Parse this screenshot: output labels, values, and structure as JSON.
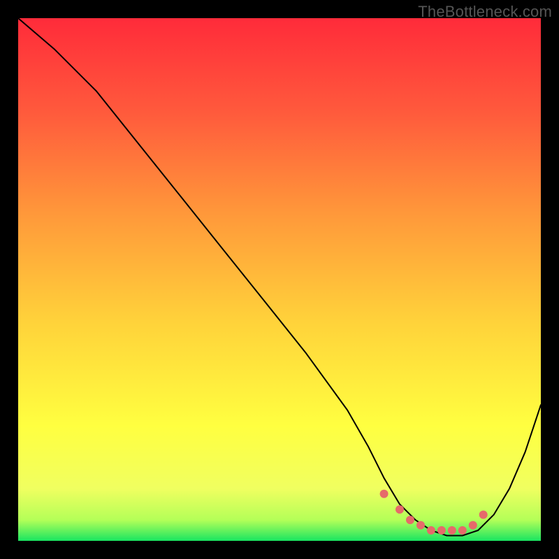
{
  "watermark": "TheBottleneck.com",
  "chart_data": {
    "type": "line",
    "title": "",
    "xlabel": "",
    "ylabel": "",
    "xlim": [
      0,
      100
    ],
    "ylim": [
      0,
      100
    ],
    "y_inverted_display": true,
    "series": [
      {
        "name": "bottleneck-curve",
        "x": [
          0,
          7,
          15,
          23,
          31,
          39,
          47,
          55,
          63,
          67,
          70,
          73,
          76,
          79,
          82,
          85,
          88,
          91,
          94,
          97,
          100
        ],
        "values": [
          100,
          94,
          86,
          76,
          66,
          56,
          46,
          36,
          25,
          18,
          12,
          7,
          4,
          2,
          1,
          1,
          2,
          5,
          10,
          17,
          26
        ]
      }
    ],
    "highlight_dots": {
      "name": "low-bottleneck-markers",
      "color": "#e66a6a",
      "radius_px": 6,
      "x": [
        70,
        73,
        75,
        77,
        79,
        81,
        83,
        85,
        87,
        89
      ],
      "values": [
        9,
        6,
        4,
        3,
        2,
        2,
        2,
        2,
        3,
        5
      ]
    },
    "gradient_stops": [
      {
        "offset": 0.0,
        "color": "#ff2b3a"
      },
      {
        "offset": 0.18,
        "color": "#ff5a3c"
      },
      {
        "offset": 0.38,
        "color": "#ff9a3a"
      },
      {
        "offset": 0.58,
        "color": "#ffd23a"
      },
      {
        "offset": 0.78,
        "color": "#ffff40"
      },
      {
        "offset": 0.9,
        "color": "#f0ff60"
      },
      {
        "offset": 0.96,
        "color": "#b4ff58"
      },
      {
        "offset": 1.0,
        "color": "#19e561"
      }
    ]
  }
}
